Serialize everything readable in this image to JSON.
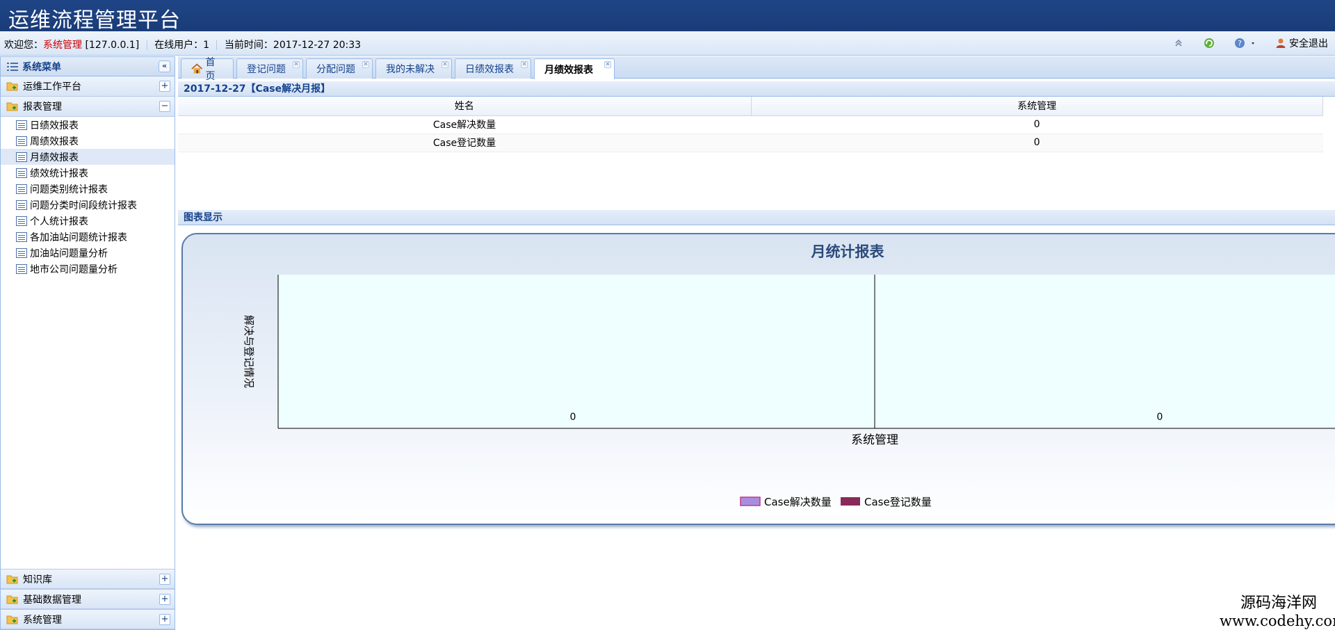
{
  "header": {
    "title": "运维流程管理平台"
  },
  "infobar": {
    "welcome_label": "欢迎您：",
    "user_name": "系统管理",
    "ip": "[127.0.0.1]",
    "online_label": "在线用户：1",
    "time_label": "当前时间：2017-12-27 20:33",
    "logout_label": "安全退出"
  },
  "sidebar": {
    "title": "系统菜单",
    "groups": [
      {
        "label": "运维工作平台",
        "state": "+"
      },
      {
        "label": "报表管理",
        "state": "−"
      }
    ],
    "items": [
      "日绩效报表",
      "周绩效报表",
      "月绩效报表",
      "绩效统计报表",
      "问题类别统计报表",
      "问题分类时间段统计报表",
      "个人统计报表",
      "各加油站问题统计报表",
      "加油站问题量分析",
      "地市公司问题量分析"
    ],
    "bottom_groups": [
      {
        "label": "知识库",
        "state": "+"
      },
      {
        "label": "基础数据管理",
        "state": "+"
      },
      {
        "label": "系统管理",
        "state": "+"
      }
    ]
  },
  "tabs": [
    "首页",
    "登记问题",
    "分配问题",
    "我的未解决",
    "日绩效报表",
    "月绩效报表"
  ],
  "report": {
    "title": "2017-12-27【Case解决月报】",
    "columns": [
      "姓名",
      "系统管理"
    ],
    "rows": [
      [
        "Case解决数量",
        "0"
      ],
      [
        "Case登记数量",
        "0"
      ]
    ]
  },
  "chart_section_title": "图表显示",
  "chart_data": {
    "type": "bar",
    "title": "月统计报表",
    "xlabel": "系统管理",
    "ylabel": "解决与登记情况",
    "categories": [
      "系统管理"
    ],
    "series": [
      {
        "name": "Case解决数量",
        "values": [
          0
        ],
        "color": "#a98ee0"
      },
      {
        "name": "Case登记数量",
        "values": [
          0
        ],
        "color": "#8a2a5a"
      }
    ],
    "plot_bg": "#effefe"
  },
  "watermark": {
    "line1": "源码海洋网",
    "line2": "www.codehy.com"
  }
}
